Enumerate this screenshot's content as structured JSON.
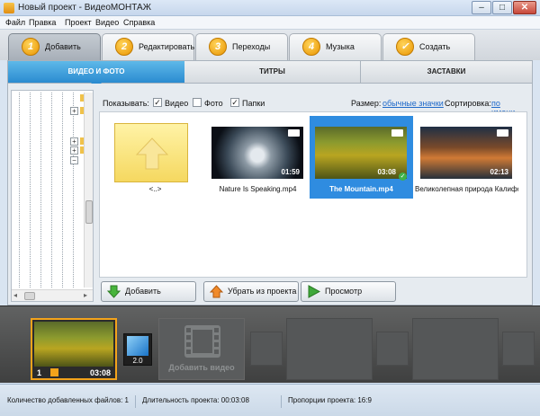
{
  "window": {
    "title": "Новый проект - ВидеоМОНТАЖ"
  },
  "menu": [
    "Файл",
    "Правка",
    "Проект",
    "Видео",
    "Справка"
  ],
  "steps": [
    {
      "num": "1",
      "label": "Добавить",
      "active": true
    },
    {
      "num": "2",
      "label": "Редактировать"
    },
    {
      "num": "3",
      "label": "Переходы"
    },
    {
      "num": "4",
      "label": "Музыка"
    },
    {
      "num": "",
      "label": "Создать"
    }
  ],
  "subtabs": {
    "video": "ВИДЕО И ФОТО",
    "titles": "ТИТРЫ",
    "intros": "ЗАСТАВКИ"
  },
  "filter": {
    "show_label": "Показывать:",
    "video": "Видео",
    "photo": "Фото",
    "folders": "Папки",
    "size_label": "Размер:",
    "size_value": "обычные значки",
    "sort_label": "Сортировка:",
    "sort_value": "по имени"
  },
  "files": [
    {
      "name": "<..>",
      "duration": ""
    },
    {
      "name": "Nature Is Speaking.mp4",
      "duration": "01:59"
    },
    {
      "name": "The Mountain.mp4",
      "duration": "03:08"
    },
    {
      "name": "Великолепная природа Калифор...",
      "duration": "02:13"
    }
  ],
  "actions": {
    "add": "Добавить",
    "remove": "Убрать из проекта",
    "preview": "Просмотр"
  },
  "timeline": {
    "clip": {
      "index": "1",
      "duration": "03:08"
    },
    "transition": "2.0",
    "add_video": "Добавить видео"
  },
  "status": {
    "files_count": "Количество добавленных файлов: 1",
    "duration": "Длительность проекта: 00:03:08",
    "aspect": "Пропорции проекта: 16:9"
  },
  "colors": {
    "accent": "#2f8ce0",
    "step_icon": "#f0a000",
    "timeline_bg": "#4f5050"
  }
}
